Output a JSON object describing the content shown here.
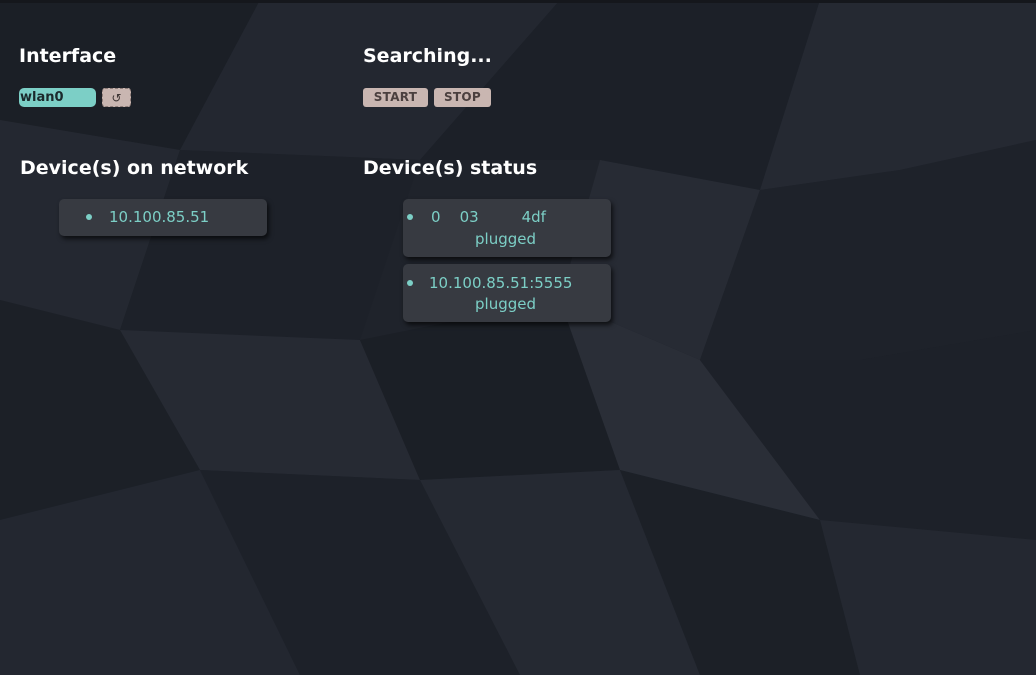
{
  "interface": {
    "heading": "Interface",
    "selected": "wlan0",
    "refresh_icon": "↺"
  },
  "search": {
    "heading": "Searching...",
    "start_label": "START",
    "stop_label": "STOP"
  },
  "network": {
    "heading": "Device(s) on network",
    "devices": [
      {
        "address": "10.100.85.51"
      }
    ]
  },
  "status": {
    "heading": "Device(s) status",
    "devices": [
      {
        "id": "0    03         4df",
        "state": "plugged"
      },
      {
        "id": "10.100.85.51:5555",
        "state": "plugged"
      }
    ]
  },
  "colors": {
    "accent": "#7ccfc6",
    "button": "#c9b6b1",
    "card": "#373a41",
    "background": "#1f232b"
  }
}
